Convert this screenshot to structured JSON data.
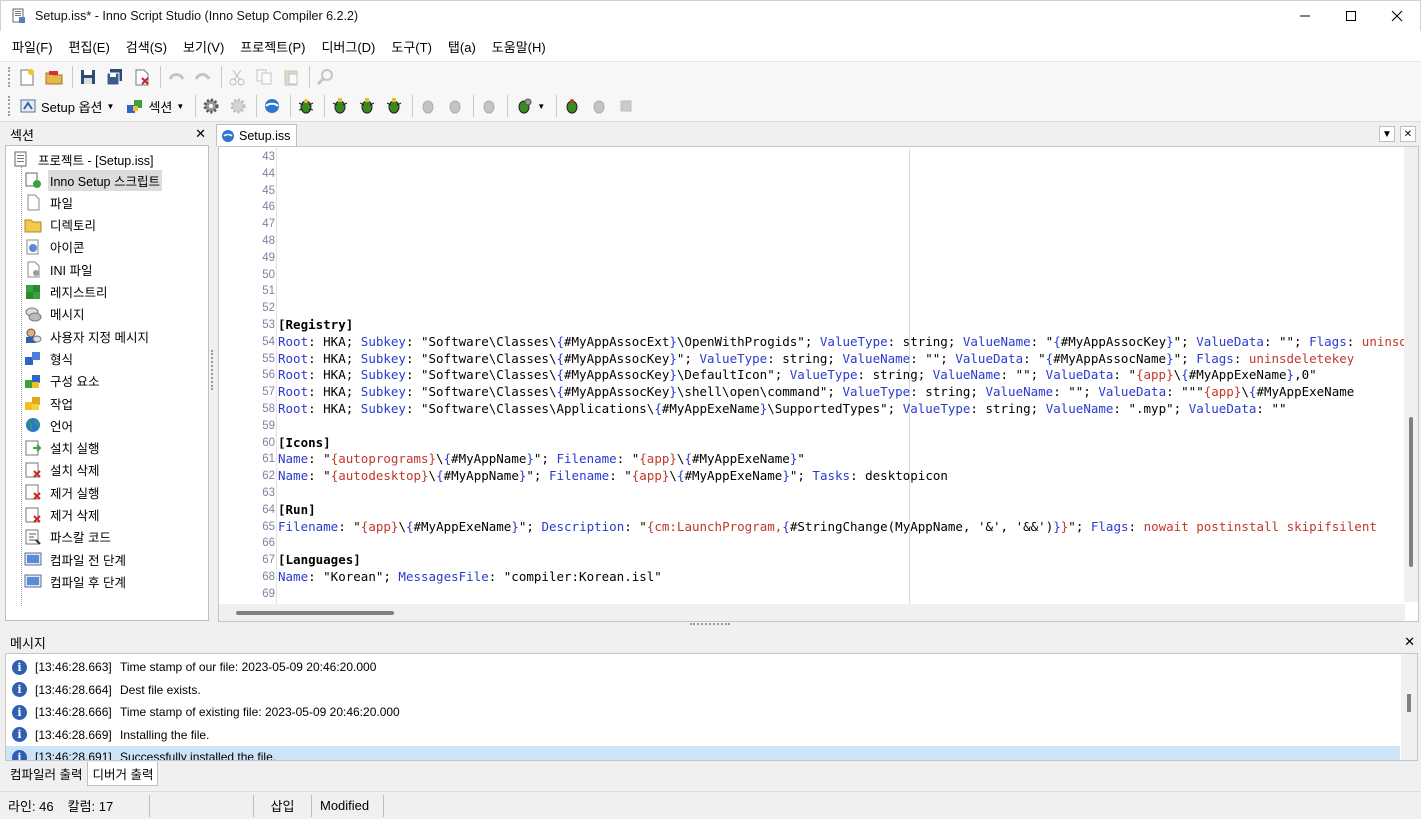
{
  "window": {
    "title": "Setup.iss* - Inno Script Studio (Inno Setup Compiler 6.2.2)"
  },
  "menu": [
    "파일(F)",
    "편집(E)",
    "검색(S)",
    "보기(V)",
    "프로젝트(P)",
    "디버그(D)",
    "도구(T)",
    "탭(a)",
    "도움말(H)"
  ],
  "toolbar2": {
    "setup_options_label": "Setup 옵션",
    "section_label": "섹션"
  },
  "section_panel": {
    "title": "섹션",
    "root_label": "프로젝트 - [Setup.iss]",
    "items": [
      "Inno Setup 스크립트",
      "파일",
      "디렉토리",
      "아이콘",
      "INI 파일",
      "레지스트리",
      "메시지",
      "사용자 지정 메시지",
      "형식",
      "구성 요소",
      "작업",
      "언어",
      "설치 실행",
      "설치 삭제",
      "제거 실행",
      "제거 삭제",
      "파스칼 코드",
      "컴파일 전 단계",
      "컴파일 후 단계"
    ],
    "selected": "Inno Setup 스크립트"
  },
  "editor": {
    "tab_label": "Setup.iss",
    "lines": [
      {
        "n": "43",
        "t": []
      },
      {
        "n": "44",
        "t": []
      },
      {
        "n": "45",
        "t": []
      },
      {
        "n": "46",
        "t": []
      },
      {
        "n": "47",
        "t": []
      },
      {
        "n": "48",
        "t": []
      },
      {
        "n": "49",
        "t": []
      },
      {
        "n": "50",
        "t": []
      },
      {
        "n": "51",
        "t": []
      },
      {
        "n": "52",
        "t": []
      },
      {
        "n": "53",
        "t": [
          [
            "sec",
            "[Registry]"
          ]
        ]
      },
      {
        "n": "54",
        "t": [
          [
            "k",
            "Root"
          ],
          [
            "s",
            ": HKA; "
          ],
          [
            "k",
            "Subkey"
          ],
          [
            "s",
            ": \"Software\\Classes\\"
          ],
          [
            "k",
            "{"
          ],
          [
            "s",
            "#MyAppAssocExt"
          ],
          [
            "k",
            "}"
          ],
          [
            "s",
            "\\OpenWithProgids\"; "
          ],
          [
            "k",
            "ValueType"
          ],
          [
            "s",
            ": string; "
          ],
          [
            "k",
            "ValueName"
          ],
          [
            "s",
            ": \""
          ],
          [
            "k",
            "{"
          ],
          [
            "s",
            "#MyAppAssocKey"
          ],
          [
            "k",
            "}"
          ],
          [
            "s",
            "\"; "
          ],
          [
            "k",
            "ValueData"
          ],
          [
            "s",
            ": \"\"; "
          ],
          [
            "k",
            "Flags"
          ],
          [
            "s",
            ": "
          ],
          [
            "v",
            "uninsdeletevalue"
          ]
        ]
      },
      {
        "n": "55",
        "t": [
          [
            "k",
            "Root"
          ],
          [
            "s",
            ": HKA; "
          ],
          [
            "k",
            "Subkey"
          ],
          [
            "s",
            ": \"Software\\Classes\\"
          ],
          [
            "k",
            "{"
          ],
          [
            "s",
            "#MyAppAssocKey"
          ],
          [
            "k",
            "}"
          ],
          [
            "s",
            "\"; "
          ],
          [
            "k",
            "ValueType"
          ],
          [
            "s",
            ": string; "
          ],
          [
            "k",
            "ValueName"
          ],
          [
            "s",
            ": \"\"; "
          ],
          [
            "k",
            "ValueData"
          ],
          [
            "s",
            ": \""
          ],
          [
            "k",
            "{"
          ],
          [
            "s",
            "#MyAppAssocName"
          ],
          [
            "k",
            "}"
          ],
          [
            "s",
            "\"; "
          ],
          [
            "k",
            "Flags"
          ],
          [
            "s",
            ": "
          ],
          [
            "v",
            "uninsdeletekey"
          ]
        ]
      },
      {
        "n": "56",
        "t": [
          [
            "k",
            "Root"
          ],
          [
            "s",
            ": HKA; "
          ],
          [
            "k",
            "Subkey"
          ],
          [
            "s",
            ": \"Software\\Classes\\"
          ],
          [
            "k",
            "{"
          ],
          [
            "s",
            "#MyAppAssocKey"
          ],
          [
            "k",
            "}"
          ],
          [
            "s",
            "\\DefaultIcon\"; "
          ],
          [
            "k",
            "ValueType"
          ],
          [
            "s",
            ": string; "
          ],
          [
            "k",
            "ValueName"
          ],
          [
            "s",
            ": \"\"; "
          ],
          [
            "k",
            "ValueData"
          ],
          [
            "s",
            ": \""
          ],
          [
            "v",
            "{app}"
          ],
          [
            "s",
            "\\"
          ],
          [
            "k",
            "{"
          ],
          [
            "s",
            "#MyAppExeName"
          ],
          [
            "k",
            "}"
          ],
          [
            "s",
            ",0\""
          ]
        ]
      },
      {
        "n": "57",
        "t": [
          [
            "k",
            "Root"
          ],
          [
            "s",
            ": HKA; "
          ],
          [
            "k",
            "Subkey"
          ],
          [
            "s",
            ": \"Software\\Classes\\"
          ],
          [
            "k",
            "{"
          ],
          [
            "s",
            "#MyAppAssocKey"
          ],
          [
            "k",
            "}"
          ],
          [
            "s",
            "\\shell\\open\\command\"; "
          ],
          [
            "k",
            "ValueType"
          ],
          [
            "s",
            ": string; "
          ],
          [
            "k",
            "ValueName"
          ],
          [
            "s",
            ": \"\"; "
          ],
          [
            "k",
            "ValueData"
          ],
          [
            "s",
            ": \"\"\""
          ],
          [
            "v",
            "{app}"
          ],
          [
            "s",
            "\\"
          ],
          [
            "k",
            "{"
          ],
          [
            "s",
            "#MyAppExeName"
          ]
        ]
      },
      {
        "n": "58",
        "t": [
          [
            "k",
            "Root"
          ],
          [
            "s",
            ": HKA; "
          ],
          [
            "k",
            "Subkey"
          ],
          [
            "s",
            ": \"Software\\Classes\\Applications\\"
          ],
          [
            "k",
            "{"
          ],
          [
            "s",
            "#MyAppExeName"
          ],
          [
            "k",
            "}"
          ],
          [
            "s",
            "\\SupportedTypes\"; "
          ],
          [
            "k",
            "ValueType"
          ],
          [
            "s",
            ": string; "
          ],
          [
            "k",
            "ValueName"
          ],
          [
            "s",
            ": \".myp\"; "
          ],
          [
            "k",
            "ValueData"
          ],
          [
            "s",
            ": \"\""
          ]
        ]
      },
      {
        "n": "59",
        "t": []
      },
      {
        "n": "60",
        "t": [
          [
            "sec",
            "[Icons]"
          ]
        ]
      },
      {
        "n": "61",
        "t": [
          [
            "k",
            "Name"
          ],
          [
            "s",
            ": \""
          ],
          [
            "v",
            "{autoprograms}"
          ],
          [
            "s",
            "\\"
          ],
          [
            "k",
            "{"
          ],
          [
            "s",
            "#MyAppName"
          ],
          [
            "k",
            "}"
          ],
          [
            "s",
            "\"; "
          ],
          [
            "k",
            "Filename"
          ],
          [
            "s",
            ": \""
          ],
          [
            "v",
            "{app}"
          ],
          [
            "s",
            "\\"
          ],
          [
            "k",
            "{"
          ],
          [
            "s",
            "#MyAppExeName"
          ],
          [
            "k",
            "}"
          ],
          [
            "s",
            "\""
          ]
        ]
      },
      {
        "n": "62",
        "t": [
          [
            "k",
            "Name"
          ],
          [
            "s",
            ": \""
          ],
          [
            "v",
            "{autodesktop}"
          ],
          [
            "s",
            "\\"
          ],
          [
            "k",
            "{"
          ],
          [
            "s",
            "#MyAppName"
          ],
          [
            "k",
            "}"
          ],
          [
            "s",
            "\"; "
          ],
          [
            "k",
            "Filename"
          ],
          [
            "s",
            ": \""
          ],
          [
            "v",
            "{app}"
          ],
          [
            "s",
            "\\"
          ],
          [
            "k",
            "{"
          ],
          [
            "s",
            "#MyAppExeName"
          ],
          [
            "k",
            "}"
          ],
          [
            "s",
            "\"; "
          ],
          [
            "k",
            "Tasks"
          ],
          [
            "s",
            ": desktopicon"
          ]
        ]
      },
      {
        "n": "63",
        "t": []
      },
      {
        "n": "64",
        "t": [
          [
            "sec",
            "[Run]"
          ]
        ]
      },
      {
        "n": "65",
        "t": [
          [
            "k",
            "Filename"
          ],
          [
            "s",
            ": \""
          ],
          [
            "v",
            "{app}"
          ],
          [
            "s",
            "\\"
          ],
          [
            "k",
            "{"
          ],
          [
            "s",
            "#MyAppExeName"
          ],
          [
            "k",
            "}"
          ],
          [
            "s",
            "\"; "
          ],
          [
            "k",
            "Description"
          ],
          [
            "s",
            ": \""
          ],
          [
            "v",
            "{cm:LaunchProgram,"
          ],
          [
            "k",
            "{"
          ],
          [
            "s",
            "#StringChange(MyAppName, '&', '&&')"
          ],
          [
            "k",
            "}"
          ],
          [
            "v",
            "}"
          ],
          [
            "s",
            "\"; "
          ],
          [
            "k",
            "Flags"
          ],
          [
            "s",
            ": "
          ],
          [
            "v",
            "nowait postinstall skipifsilent"
          ]
        ]
      },
      {
        "n": "66",
        "t": []
      },
      {
        "n": "67",
        "t": [
          [
            "sec",
            "[Languages]"
          ]
        ]
      },
      {
        "n": "68",
        "t": [
          [
            "k",
            "Name"
          ],
          [
            "s",
            ": \"Korean\"; "
          ],
          [
            "k",
            "MessagesFile"
          ],
          [
            "s",
            ": \"compiler:Korean.isl\""
          ]
        ]
      },
      {
        "n": "69",
        "t": []
      }
    ]
  },
  "messages": {
    "title": "메시지",
    "rows": [
      {
        "time": "[13:46:28.663]",
        "text": "Time stamp of our file: 2023-05-09 20:46:20.000"
      },
      {
        "time": "[13:46:28.664]",
        "text": "Dest file exists."
      },
      {
        "time": "[13:46:28.666]",
        "text": "Time stamp of existing file: 2023-05-09 20:46:20.000"
      },
      {
        "time": "[13:46:28.669]",
        "text": "Installing the file."
      },
      {
        "time": "[13:46:28.691]",
        "text": "Successfully installed the file."
      }
    ],
    "tabs": [
      "컴파일러 출력",
      "디버거 출력"
    ],
    "active_tab": "디버거 출력"
  },
  "status": {
    "line": "라인: 46",
    "column": "칼럼: 17",
    "empty": "",
    "mode": "삽입",
    "modified": "Modified"
  }
}
